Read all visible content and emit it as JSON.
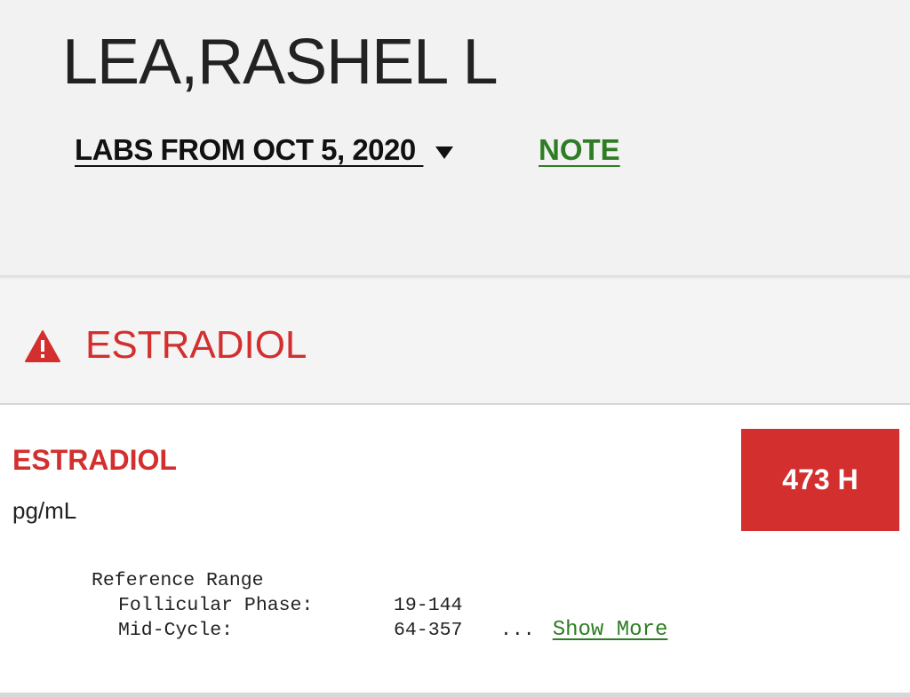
{
  "patient": {
    "name": "LEA,RASHEL L"
  },
  "labs_selector": {
    "label": "LABS FROM OCT 5, 2020 "
  },
  "note_link": {
    "label": "NOTE"
  },
  "section": {
    "title": "ESTRADIOL",
    "icon": "warning-icon"
  },
  "result": {
    "test_name": "ESTRADIOL",
    "unit": "pg/mL",
    "value": "473 H",
    "reference": {
      "heading": "Reference Range",
      "rows": [
        {
          "label": "Follicular Phase:",
          "value": "19-144"
        },
        {
          "label": "Mid-Cycle:",
          "value": "64-357"
        }
      ],
      "ellipsis": "...",
      "show_more_label": "Show More"
    }
  },
  "colors": {
    "alert": "#d32f2f",
    "link": "#2e7d24",
    "background": "#f2f2f2"
  }
}
